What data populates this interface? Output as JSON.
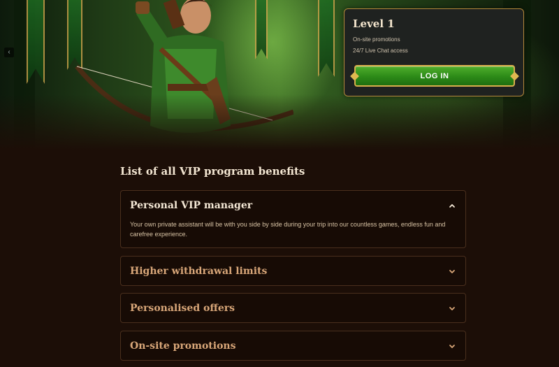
{
  "hero": {
    "prev_arrow": "‹"
  },
  "level_card": {
    "title": "Level 1",
    "perks": [
      "On-site promotions",
      "24/7 Live Chat access"
    ],
    "login_label": "LOG IN"
  },
  "benefits": {
    "title": "List of all VIP program benefits",
    "items": [
      {
        "title": "Personal VIP manager",
        "expanded": true,
        "body": "Your own private assistant will be with you side by side during your trip into our countless games, endless fun and carefree experience."
      },
      {
        "title": "Higher withdrawal limits",
        "expanded": false
      },
      {
        "title": "Personalised offers",
        "expanded": false
      },
      {
        "title": "On-site promotions",
        "expanded": false
      }
    ]
  },
  "colors": {
    "background": "#1c0e07",
    "accent_gold": "#b58a3c",
    "button_green": "#2c8a18",
    "heading_closed": "#d9a779"
  }
}
